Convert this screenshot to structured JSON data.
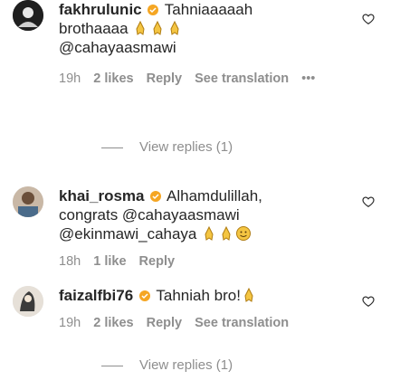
{
  "comments": [
    {
      "username": "fakhrulunic",
      "text_line1": "Tahniaaaaah",
      "text_line2": "brothaaaa",
      "text_line3": "@cahayaasmawi",
      "time": "19h",
      "likes": "2 likes",
      "reply": "Reply",
      "translation": "See translation",
      "more": "•••",
      "view_replies": "View replies (1)"
    },
    {
      "username": "khai_rosma",
      "text_line1": "Alhamdulillah,",
      "text_line2": "congrats @cahayaasmawi",
      "text_line3": "@ekinmawi_cahaya",
      "time": "18h",
      "likes": "1 like",
      "reply": "Reply"
    },
    {
      "username": "faizalfbi76",
      "text_line1": "Tahniah bro!",
      "time": "19h",
      "likes": "2 likes",
      "reply": "Reply",
      "translation": "See translation",
      "view_replies": "View replies (1)"
    }
  ],
  "colors": {
    "text": "#262626",
    "secondary": "#8e8e8e",
    "verified_orange": "#f5a623"
  },
  "icons": {
    "like": "heart-outline-icon",
    "emoji": "praying-hands-emoji",
    "badge": "verified-badge-icon"
  }
}
